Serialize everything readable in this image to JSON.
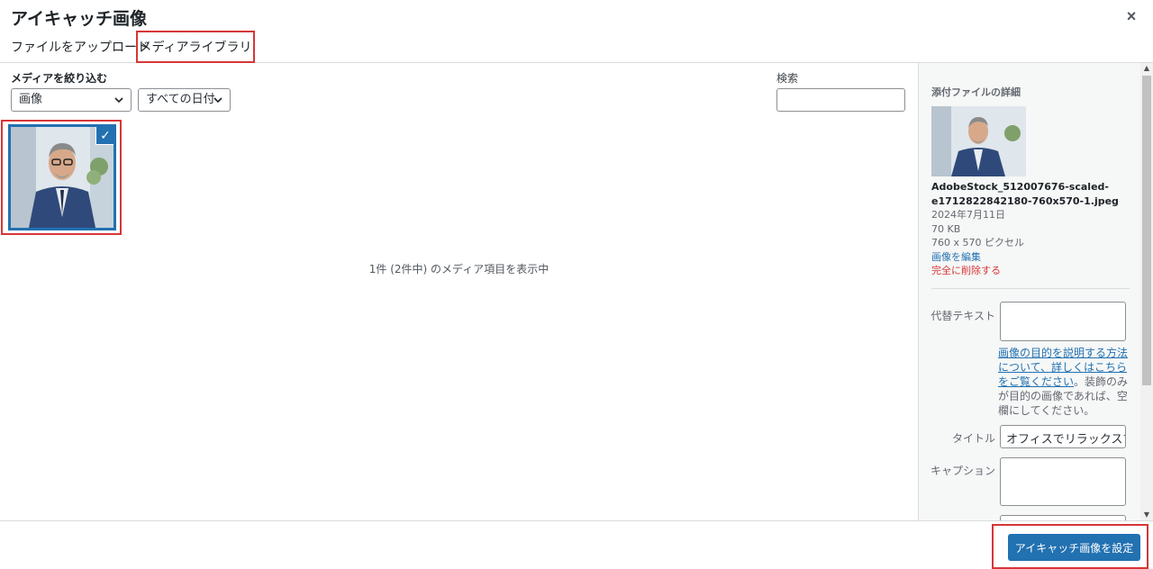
{
  "modal": {
    "title": "アイキャッチ画像",
    "close_label": "×"
  },
  "tabs": [
    {
      "label": "ファイルをアップロード"
    },
    {
      "label": "メディアライブラリ"
    }
  ],
  "filters": {
    "label": "メディアを絞り込む",
    "type_selected": "画像",
    "date_selected": "すべての日付",
    "search_label": "検索",
    "search_value": ""
  },
  "library": {
    "count_text": "1件 (2件中) のメディア項目を表示中",
    "selected_check": "✓"
  },
  "details": {
    "heading": "添付ファイルの詳細",
    "filename": "AdobeStock_512007676-scaled-e1712822842180-760x570-1.jpeg",
    "date": "2024年7月11日",
    "size": "70 KB",
    "dimensions": "760 x 570 ピクセル",
    "edit_link": "画像を編集",
    "delete_link": "完全に削除する",
    "alt_label": "代替テキスト",
    "alt_value": "",
    "help_link": "画像の目的を説明する方法について、詳しくはこちらをご覧ください",
    "help_text": "。装飾のみが目的の画像であれば、空欄にしてください。",
    "title_label": "タイトル",
    "title_value": "オフィスでリラックスす",
    "caption_label": "キャプション",
    "caption_value": ""
  },
  "footer": {
    "button_label": "アイキャッチ画像を設定"
  },
  "colors": {
    "primary": "#2271b1",
    "highlight": "#d63638",
    "danger": "#d63638"
  }
}
